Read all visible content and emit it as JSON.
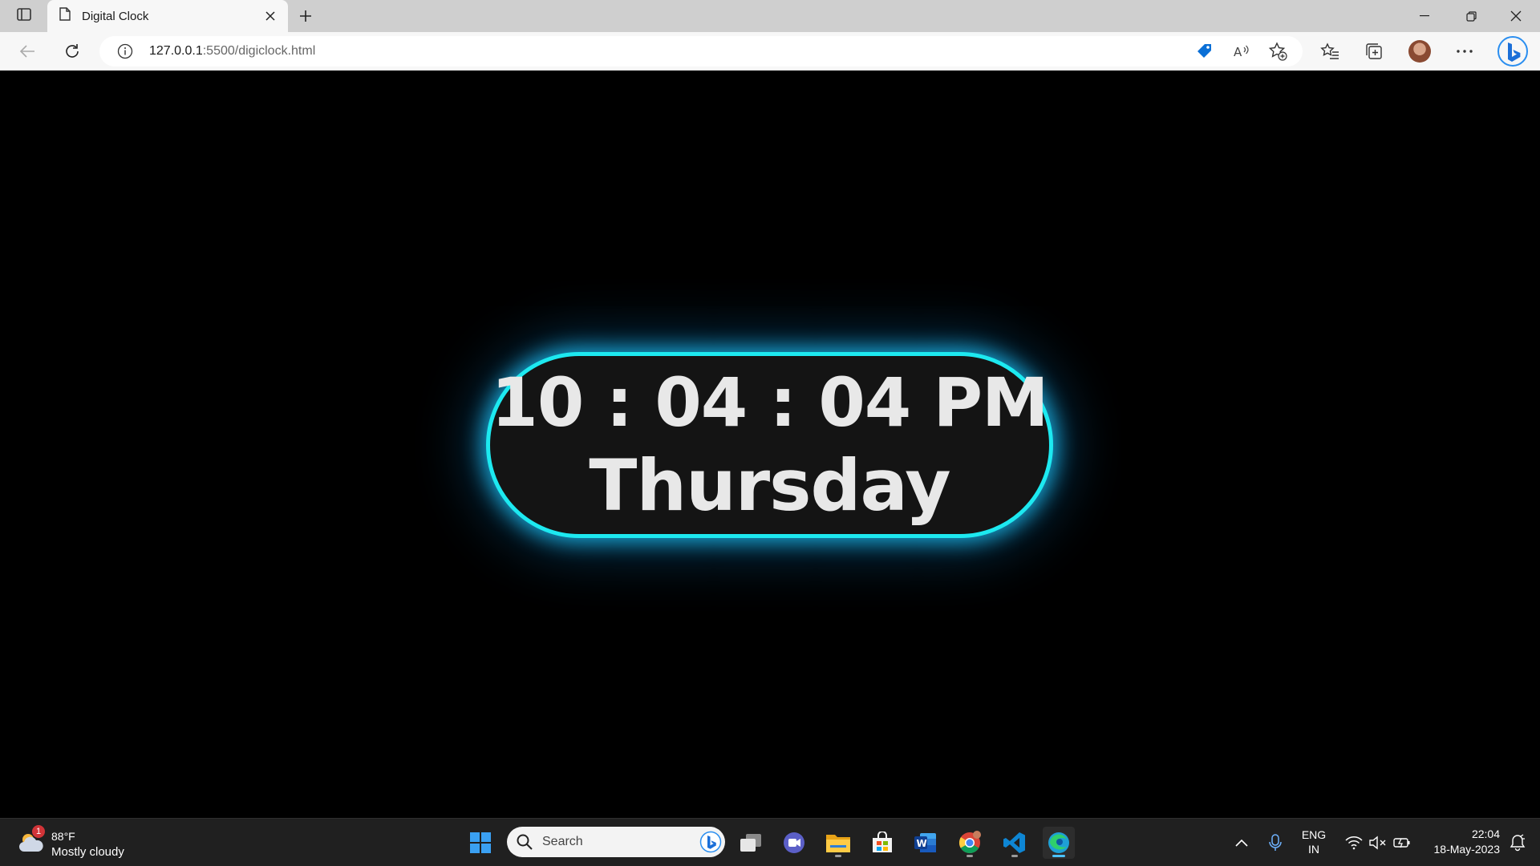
{
  "browser": {
    "tab_title": "Digital Clock",
    "url_host": "127.0.0.1",
    "url_path": ":5500/digiclock.html"
  },
  "clock": {
    "time": "10 : 04 : 04 PM",
    "day": "Thursday",
    "accent_color": "#1de9f0"
  },
  "taskbar": {
    "weather": {
      "badge": "1",
      "temp": "88°F",
      "condition": "Mostly cloudy"
    },
    "search_placeholder": "Search",
    "lang_line1": "ENG",
    "lang_line2": "IN",
    "time": "22:04",
    "date": "18-May-2023"
  },
  "icons": [
    "tab-actions-icon",
    "page-icon",
    "close-icon",
    "plus-icon",
    "minimize-icon",
    "restore-icon",
    "back-icon",
    "refresh-icon",
    "info-icon",
    "shopping-tag-icon",
    "read-aloud-icon",
    "add-favorite-icon",
    "favorites-icon",
    "collections-icon",
    "more-icon",
    "bing-icon",
    "start-icon",
    "search-icon",
    "task-view-icon",
    "teams-chat-icon",
    "file-explorer-icon",
    "store-icon",
    "word-icon",
    "chrome-icon",
    "vscode-icon",
    "edge-icon",
    "chevron-up-icon",
    "microphone-icon",
    "wifi-icon",
    "speaker-muted-icon",
    "battery-icon",
    "notification-icon"
  ]
}
